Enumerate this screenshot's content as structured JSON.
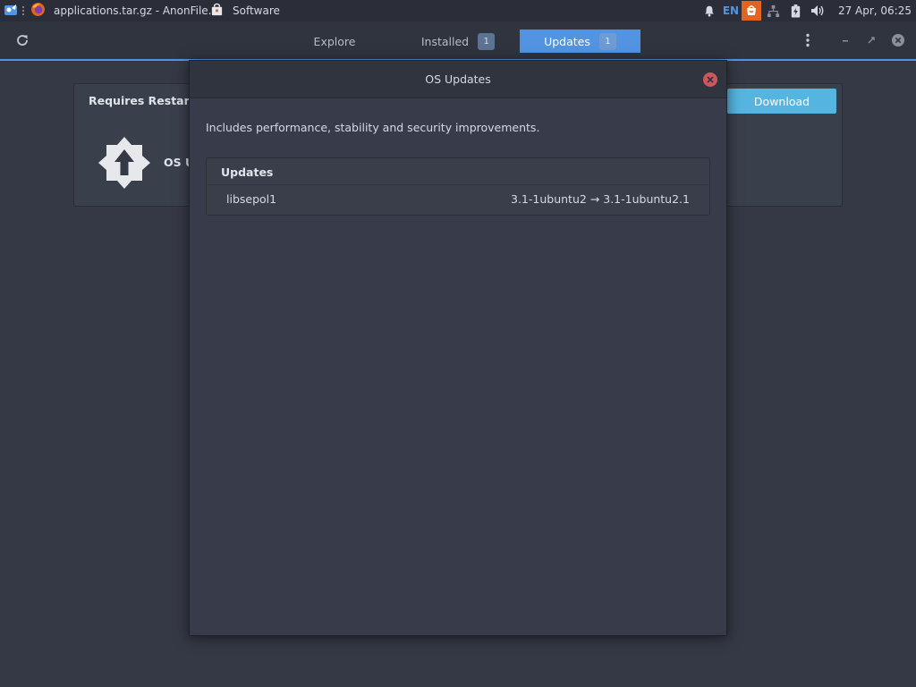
{
  "panel": {
    "window_title": "applications.tar.gz - AnonFile...",
    "app_name": "Software",
    "keyboard_layout": "EN",
    "datetime": "27 Apr, 06:25"
  },
  "headerbar": {
    "tabs": [
      {
        "label": "Explore"
      },
      {
        "label": "Installed",
        "count": "1"
      },
      {
        "label": "Updates",
        "count": "1",
        "active": true
      }
    ]
  },
  "background": {
    "card_header": "Requires Restart",
    "download_label": "Download",
    "os_updates_label_partial": "OS U"
  },
  "dialog": {
    "title": "OS Updates",
    "description": "Includes performance, stability and security improvements.",
    "section_title": "Updates",
    "updates": [
      {
        "package": "libsepol1",
        "version_change": "3.1-1ubuntu2 → 3.1-1ubuntu2.1"
      }
    ]
  },
  "colors": {
    "accent": "#5294e2",
    "download_button": "#56b5e0",
    "close_button": "#cc575d",
    "background": "#353945"
  }
}
